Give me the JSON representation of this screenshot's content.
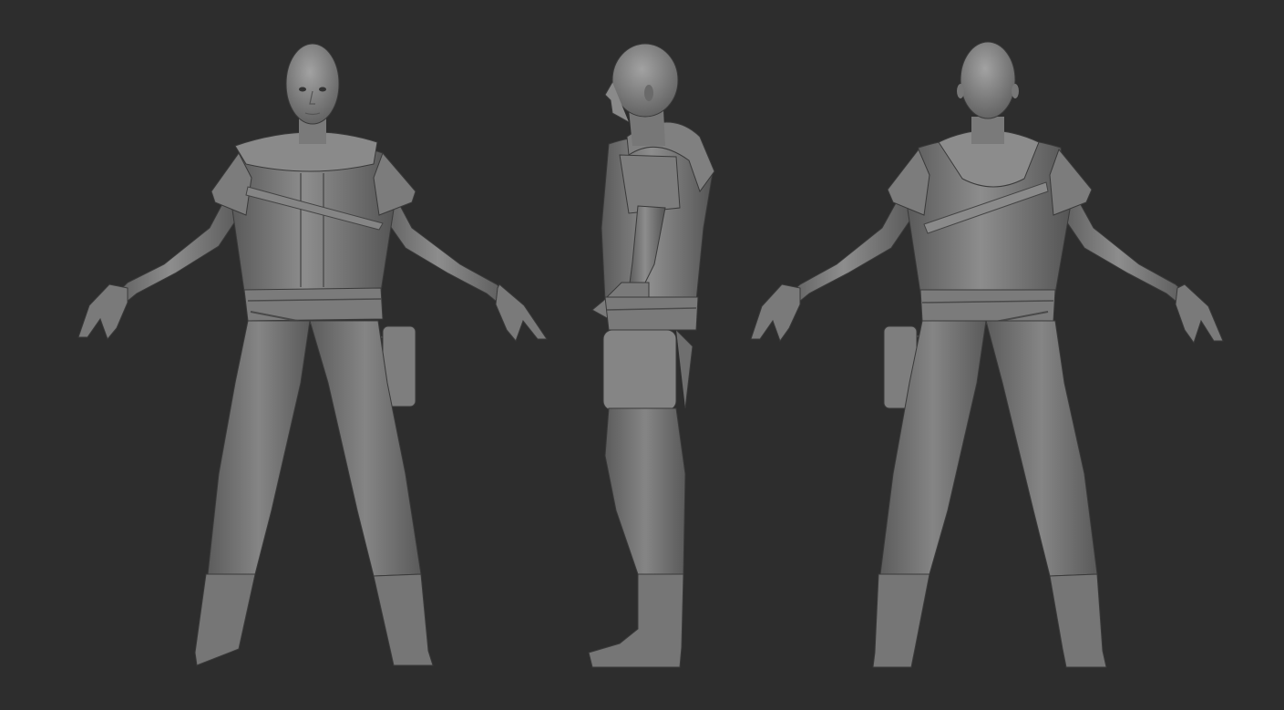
{
  "scene": {
    "views": [
      {
        "id": "front",
        "label": ""
      },
      {
        "id": "side",
        "label": ""
      },
      {
        "id": "back",
        "label": ""
      }
    ]
  },
  "colors": {
    "background": "#2d2d2d",
    "clay_light": "#8a8a8a",
    "clay_mid": "#6f6f6f",
    "clay_dark": "#4e4e4e",
    "clay_shadow": "#3a3a3a"
  }
}
